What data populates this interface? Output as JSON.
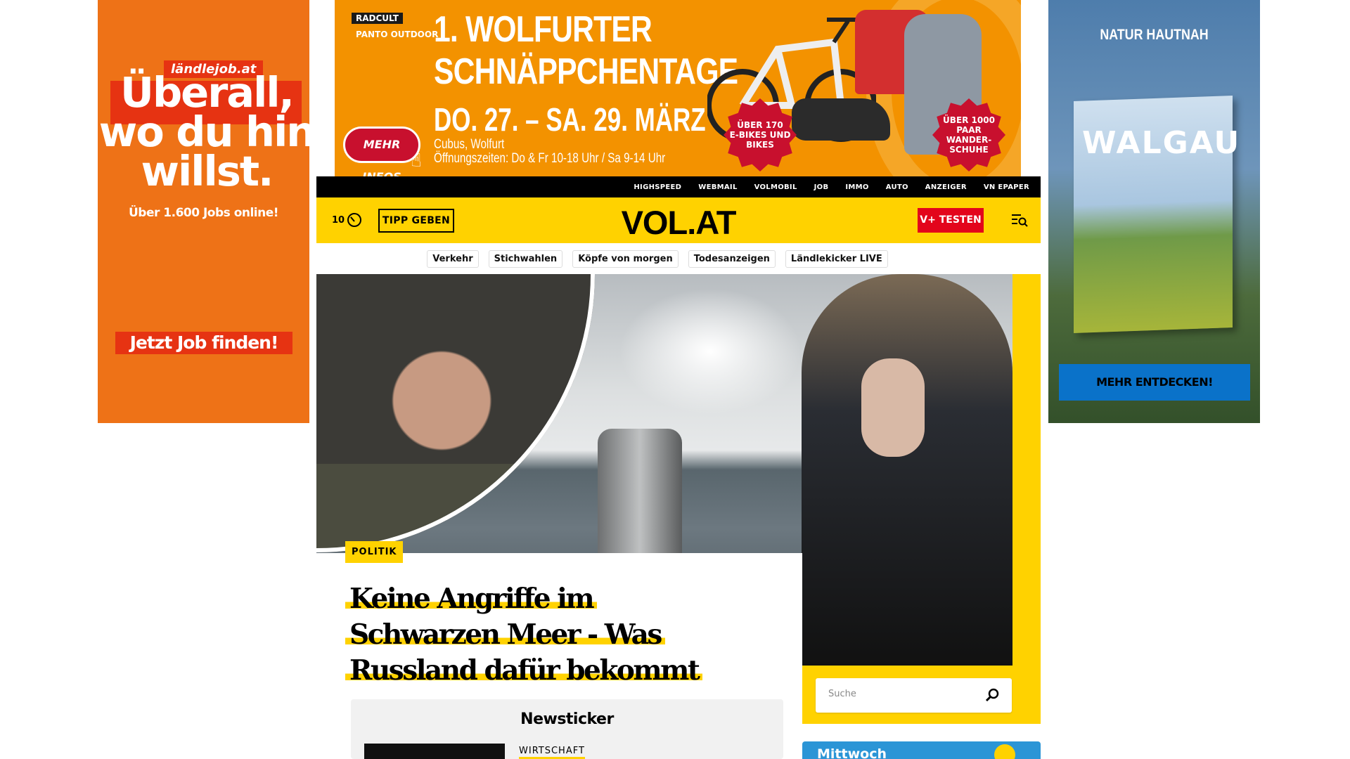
{
  "ads": {
    "left": {
      "brand": "ländlejob.at",
      "headline": "Überall,\nwo du hin\nwillst.",
      "subline": "Über 1.600 Jobs online!",
      "cta": "Jetzt Job finden!"
    },
    "top": {
      "logo1": "RADCULT",
      "logo2": "PANTO OUTDOOR",
      "title": "1. WOLFURTER\nSCHNÄPPCHENTAGE",
      "dates": "DO. 27. – SA. 29. MÄRZ",
      "location": "Cubus, Wolfurt\nÖffnungszeiten: Do & Fr 10-18 Uhr / Sa 9-14 Uhr",
      "info_button": "MEHR INFOS",
      "badge1": "ÜBER 170\nE-BIKES UND\nBIKES",
      "badge2": "ÜBER 1000\nPAAR WANDER-\nSCHUHE"
    },
    "right": {
      "title": "NATUR HAUTNAH",
      "book_title": "WALGAU",
      "cta": "MEHR ENTDECKEN!"
    }
  },
  "topbar": {
    "links": [
      "HIGHSPEED",
      "WEBMAIL",
      "VOLMOBIL",
      "JOB",
      "IMMO",
      "AUTO",
      "ANZEIGER",
      "VN EPAPER"
    ]
  },
  "header": {
    "count": "10",
    "tipp": "TIPP GEBEN",
    "logo": "VOL.AT",
    "vplus": "V+ TESTEN"
  },
  "pills": [
    "Verkehr",
    "Stichwahlen",
    "Köpfe von morgen",
    "Todesanzeigen",
    "Ländlekicker LIVE"
  ],
  "hero": {
    "tag": "POLITIK",
    "headline": "Keine Angriffe im Schwarzen Meer - Was Russland dafür bekommt"
  },
  "ticker": {
    "title": "Newsticker",
    "category": "WIRTSCHAFT"
  },
  "search": {
    "placeholder": "Suche"
  },
  "weather": {
    "day": "Mittwoch"
  },
  "colors": {
    "brand_yellow": "#ffd200",
    "accent_red": "#e3051b",
    "ad_orange": "#ee7217"
  }
}
